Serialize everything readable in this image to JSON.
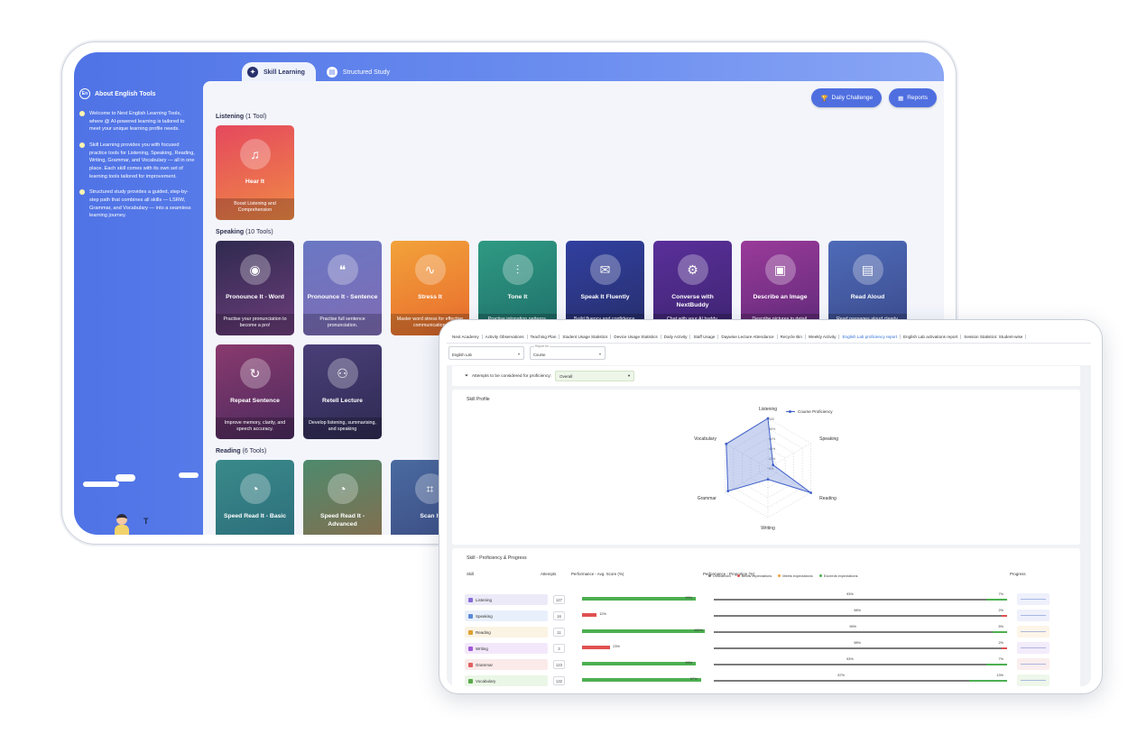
{
  "tablet": {
    "tabs": [
      {
        "label": "Skill Learning",
        "icon": "bulb-icon"
      },
      {
        "label": "Structured Study",
        "icon": "book-icon"
      }
    ],
    "sidebar": {
      "title": "About English Tools",
      "items": [
        "Welcome to Next English Learning Tools, where @ AI-powered learning is tailored to meet your unique learning profile needs.",
        "Skill Learning provides you with focused practice tools for Listening, Speaking, Reading, Writing, Grammar, and Vocabulary — all in one place. Each skill comes with its own set of learning tools tailored for improvement.",
        "Structured study provides a guided, step-by-step path that combines all skills — LSRW, Grammar, and Vocabulary — into a seamless learning journey."
      ]
    },
    "buttons": {
      "daily": "Daily Challenge",
      "reports": "Reports"
    },
    "listening": {
      "title": "Listening",
      "count": "(1 Tool)",
      "cards": [
        {
          "name": "Hear It",
          "desc": "Boost Listening and Comprehension",
          "color": "#e5485e",
          "color2": "#f08a45",
          "icon": "ear-icon"
        }
      ]
    },
    "speaking": {
      "title": "Speaking",
      "count": "(10 Tools)",
      "cards": [
        {
          "name": "Pronounce It - Word",
          "desc": "Practise your pronunciation to become a pro!",
          "color": "#2f2a4f",
          "color2": "#6b3d7a",
          "icon": "speaker-icon"
        },
        {
          "name": "Pronounce It - Sentence",
          "desc": "Practise full sentence pronunciation.",
          "color": "#6a78c4",
          "color2": "#7f6bb3",
          "icon": "quote-icon"
        },
        {
          "name": "Stress It",
          "desc": "Master word stress for effective communication.",
          "color": "#f2a23a",
          "color2": "#e86b2d",
          "icon": "wave-icon"
        },
        {
          "name": "Tone It",
          "desc": "Practise intonation patterns.",
          "color": "#2f9a83",
          "color2": "#1f6f6a",
          "icon": "sound-icon"
        },
        {
          "name": "Speak It Fluently",
          "desc": "Build fluency and confidence.",
          "color": "#3140a0",
          "color2": "#272e6a",
          "icon": "chat-icon"
        },
        {
          "name": "Converse with NextBuddy",
          "desc": "Chat with your AI buddy.",
          "color": "#5a2f9a",
          "color2": "#3d2470",
          "icon": "robot-icon"
        },
        {
          "name": "Describe an Image",
          "desc": "Describe pictures in detail.",
          "color": "#9a3a9a",
          "color2": "#5e2a78",
          "icon": "image-icon"
        },
        {
          "name": "Read Aloud",
          "desc": "Read passages aloud clearly.",
          "color": "#4e6bb8",
          "color2": "#3b4a8c",
          "icon": "read-icon"
        },
        {
          "name": "Repeat Sentence",
          "desc": "Improve memory, clarity, and speech accuracy.",
          "color": "#8a3a6e",
          "color2": "#4a2a5e",
          "icon": "repeat-icon"
        },
        {
          "name": "Retell Lecture",
          "desc": "Develop listening, summarising, and speaking",
          "color": "#4a3f78",
          "color2": "#2e2a52",
          "icon": "people-icon"
        }
      ]
    },
    "reading": {
      "title": "Reading",
      "count": "(6 Tools)",
      "cards": [
        {
          "name": "Speed Read It - Basic",
          "desc": "",
          "color": "#3a8a8a",
          "color2": "#2a6a7a",
          "icon": "gauge-icon"
        },
        {
          "name": "Speed Read It - Advanced",
          "desc": "",
          "color": "#4e8a6e",
          "color2": "#8a6a4a",
          "icon": "gauge-icon"
        },
        {
          "name": "Scan It",
          "desc": "",
          "color": "#4a6aa0",
          "color2": "#3a4a80",
          "icon": "scan-icon"
        }
      ]
    }
  },
  "report": {
    "nav_tabs": [
      "Next Academy",
      "Activity Observations",
      "Teaching Plan",
      "Student Usage Statistics",
      "Device Usage Statistics",
      "Daily Activity",
      "Staff Usage",
      "Daywise Lecture Attendance",
      "Recycle Bin",
      "Weekly Activity",
      "English Lab proficiency report",
      "English Lab activations report",
      "Session Statistics: Student-wise"
    ],
    "selected_tab": "English Lab proficiency report",
    "filters": [
      {
        "label": "",
        "value": "English Lab"
      },
      {
        "label": "Report for",
        "value": "Course"
      }
    ],
    "attempts_label": "Attempts to be considered for proficiency:",
    "attempts_value": "Overall",
    "skill_profile_title": "Skill Profile",
    "radar": {
      "legend": "Course Proficiency",
      "axes": [
        "Listening",
        "Speaking",
        "Reading",
        "Writing",
        "Grammar",
        "Vocabulary"
      ],
      "ticks": [
        "100",
        "80%",
        "60%",
        "40%",
        "20%",
        "0%"
      ],
      "values": [
        100,
        12,
        100,
        23,
        93,
        97
      ],
      "colors": {
        "line": "#4060c8",
        "fill": "#6a86d8"
      }
    },
    "progress_title": "Skill - Proficiency & Progress",
    "columns": {
      "skill": "Skill",
      "attempts": "Attempts",
      "avg": "Performance - Avg. Score (%)",
      "prop": "Performance - Proportion (%)",
      "progress": "Progress"
    },
    "legend": [
      {
        "label": "Unscanned",
        "color": "#7a7a7a"
      },
      {
        "label": "Below expectations",
        "color": "#e05050"
      },
      {
        "label": "Meets expectations",
        "color": "#f0a040"
      },
      {
        "label": "Exceeds expectations",
        "color": "#4caf50"
      }
    ],
    "rows": [
      {
        "skill": "Listening",
        "attempts": "127",
        "avg": 93,
        "avg_label": "93%",
        "avg_color": "#4caf50",
        "gray": 93,
        "red": 0,
        "green": 7,
        "gray_label": "93%",
        "end_label": "7%",
        "chip": "#eceaf8",
        "icon_color": "#8a6ad8",
        "spark": "#eef0fb"
      },
      {
        "skill": "Speaking",
        "attempts": "16",
        "avg": 12,
        "avg_label": "12%",
        "avg_color": "#e05050",
        "gray": 98,
        "red": 2,
        "green": 0,
        "gray_label": "98%",
        "end_label": "2%",
        "chip": "#e8f0fb",
        "icon_color": "#5a8ad8",
        "spark": "#eef0fb"
      },
      {
        "skill": "Reading",
        "attempts": "11",
        "avg": 100,
        "avg_label": "100%",
        "avg_color": "#4caf50",
        "gray": 95,
        "red": 0,
        "green": 5,
        "gray_label": "95%",
        "end_label": "5%",
        "chip": "#fbf3e4",
        "icon_color": "#e0a030",
        "spark": "#fdf5e8"
      },
      {
        "skill": "Writing",
        "attempts": "3",
        "avg": 23,
        "avg_label": "23%",
        "avg_color": "#e05050",
        "gray": 98,
        "red": 2,
        "green": 0,
        "gray_label": "98%",
        "end_label": "2%",
        "chip": "#f3e8fb",
        "icon_color": "#a05ad8",
        "spark": "#f3ecfb"
      },
      {
        "skill": "Grammar",
        "attempts": "123",
        "avg": 93,
        "avg_label": "93%",
        "avg_color": "#4caf50",
        "gray": 93,
        "red": 0,
        "green": 7,
        "gray_label": "93%",
        "end_label": "7%",
        "chip": "#fbeaea",
        "icon_color": "#e06060",
        "spark": "#fbeeee"
      },
      {
        "skill": "Vocabulary",
        "attempts": "132",
        "avg": 97,
        "avg_label": "97%",
        "avg_color": "#4caf50",
        "gray": 87,
        "red": 0,
        "green": 13,
        "gray_label": "87%",
        "end_label": "13%",
        "chip": "#eaf6e6",
        "icon_color": "#5aa84a",
        "spark": "#eef7ea"
      }
    ]
  }
}
